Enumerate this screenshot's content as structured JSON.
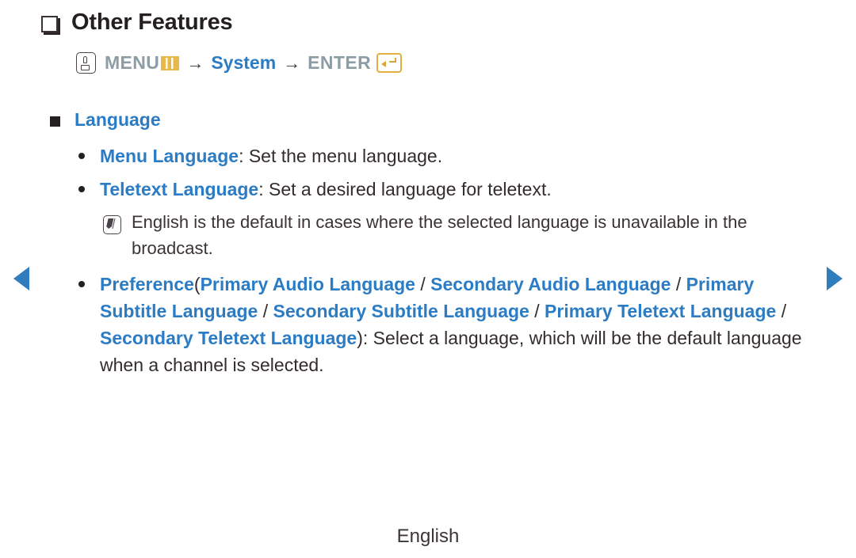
{
  "colors": {
    "accent_blue": "#2b7cc4",
    "nav_blue": "#2f7cbf",
    "menu_grey": "#8d9da5",
    "gold": "#e2af3e",
    "text_dark": "#342c2c"
  },
  "header": {
    "bullet_icon": "checkbox-bullet-icon",
    "title": "Other Features"
  },
  "menu_path": {
    "touch_icon": "touch-hand-icon",
    "menu_label": "MENU",
    "menu_bars_icon": "menu-bars-icon",
    "arrow1": "→",
    "system_label": "System",
    "arrow2": "→",
    "enter_label": "ENTER",
    "enter_icon": "enter-return-icon"
  },
  "section": {
    "bullet_icon": "square-bullet-icon",
    "title": "Language"
  },
  "items": [
    {
      "bullet_icon": "dot-bullet-icon",
      "term": "Menu Language",
      "description": ": Set the menu language."
    },
    {
      "bullet_icon": "dot-bullet-icon",
      "term": "Teletext Language",
      "description": ": Set a desired language for teletext."
    }
  ],
  "note": {
    "icon": "note-pencil-icon",
    "text": "English is the default in cases where the selected language is unavailable in the broadcast."
  },
  "preference": {
    "bullet_icon": "dot-bullet-icon",
    "term": "Preference",
    "open_paren": "(",
    "options": [
      "Primary Audio Language",
      "Secondary Audio Language",
      "Primary Subtitle Language",
      "Secondary Subtitle Language",
      "Primary Teletext Language",
      "Secondary Teletext Language"
    ],
    "separator": " / ",
    "close_paren": ")",
    "description": ": Select a language, which will be the default language when a channel is selected."
  },
  "navigation": {
    "prev_icon": "nav-prev-arrow-icon",
    "next_icon": "nav-next-arrow-icon"
  },
  "footer": {
    "label": "English"
  }
}
